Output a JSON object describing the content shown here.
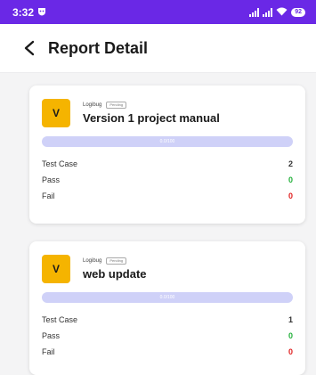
{
  "status_bar": {
    "time": "3:32",
    "battery": "92"
  },
  "header": {
    "title": "Report Detail"
  },
  "reports": [
    {
      "avatar_letter": "V",
      "company": "Logibug",
      "status": "Pending",
      "project_name": "Version 1 project manual",
      "progress_text": "0.0/100",
      "progress_fraction": 0,
      "stats": [
        {
          "label": "Test Case",
          "value": "2"
        },
        {
          "label": "Pass",
          "value": "0"
        },
        {
          "label": "Fail",
          "value": "0"
        }
      ]
    },
    {
      "avatar_letter": "V",
      "company": "Logibug",
      "status": "Pending",
      "project_name": "web update",
      "progress_text": "0.0/100",
      "progress_fraction": 0,
      "stats": [
        {
          "label": "Test Case",
          "value": "1"
        },
        {
          "label": "Pass",
          "value": "0"
        },
        {
          "label": "Fail",
          "value": "0"
        }
      ]
    }
  ],
  "colors": {
    "status_bar": "#6a28e6",
    "avatar": "#f5b400",
    "progress_track": "#cfd1f8",
    "pass": "#22b03a",
    "fail": "#e02020"
  }
}
